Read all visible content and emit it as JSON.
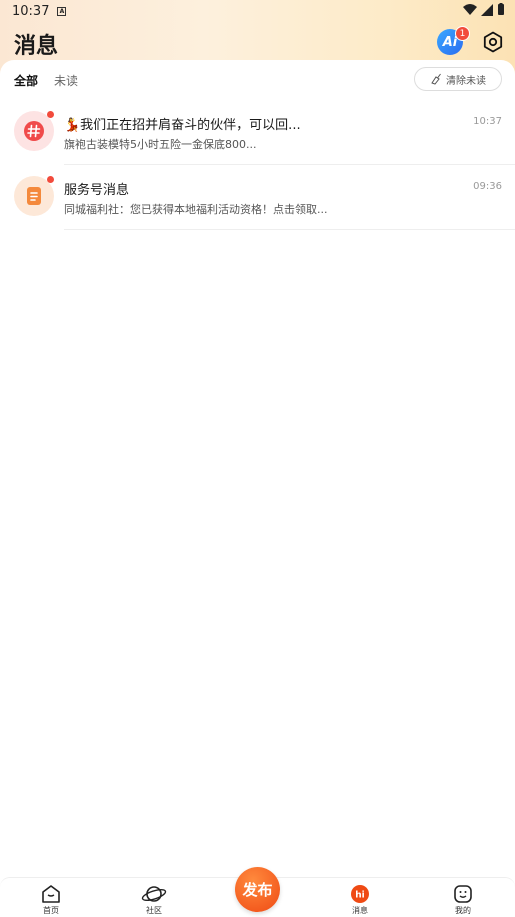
{
  "status_bar": {
    "time": "10:37",
    "notification_glyph": "A"
  },
  "header": {
    "title": "消息",
    "ai_label": "Ai",
    "ai_badge_count": "1"
  },
  "tabs": [
    {
      "label": "全部",
      "active": true
    },
    {
      "label": "未读",
      "active": false
    }
  ],
  "clear_unread_label": "清除未读",
  "messages": [
    {
      "title": "💃我们正在招并肩奋斗的伙伴，可以回...",
      "subtitle": "旗袍古装模特5小时五险一金保底800...",
      "time": "10:37",
      "icon": "hashtag-icon",
      "unread": true
    },
    {
      "title": "服务号消息",
      "subtitle": "同城福利社：您已获得本地福利活动资格！点击领取...",
      "time": "09:36",
      "icon": "document-icon",
      "unread": true
    }
  ],
  "bottom_nav": {
    "items": [
      {
        "label": "首页",
        "icon": "home-icon"
      },
      {
        "label": "社区",
        "icon": "planet-icon"
      },
      {
        "label": "消息",
        "icon": "hi-chat-icon",
        "active": true
      },
      {
        "label": "我的",
        "icon": "face-icon"
      }
    ],
    "publish_label": "发布"
  },
  "colors": {
    "accent": "#ef4a14",
    "badge": "#f24b3c",
    "ai_blue": "#2b6cf0"
  }
}
